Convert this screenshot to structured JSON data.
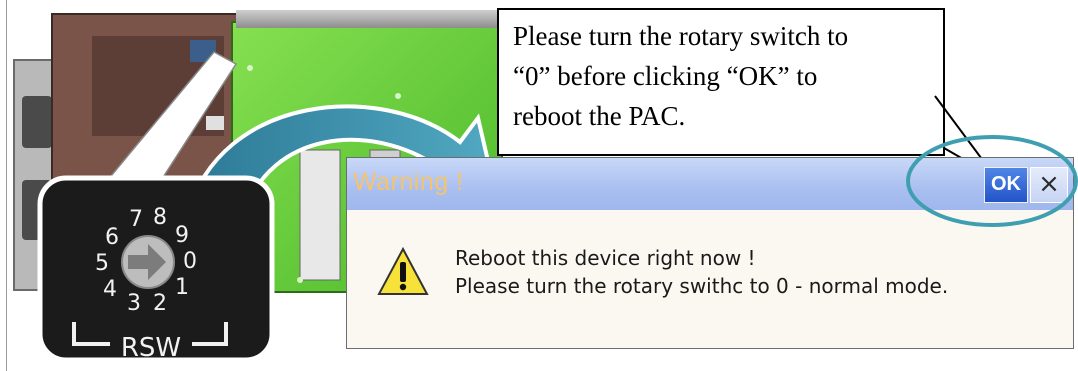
{
  "callout": {
    "lines": [
      "Please turn the rotary switch to",
      "“0” before clicking “OK” to",
      "reboot the PAC."
    ]
  },
  "rotary_switch": {
    "label": "RSW",
    "digits": [
      "0",
      "1",
      "2",
      "3",
      "4",
      "5",
      "6",
      "7",
      "8",
      "9"
    ]
  },
  "dialog": {
    "title": "Warning !",
    "ok_label": "OK",
    "close_label": "×",
    "message_line1": "Reboot this device right now !",
    "message_line2": "Please turn the rotary swithc to 0 - normal mode.",
    "icon": "warning-icon"
  },
  "colors": {
    "titlebar": "#a9bff0",
    "ok_button": "#2f62d6",
    "highlight": "#3f9fb0",
    "arrow": "#2a7f99",
    "board": "#6fd43a"
  }
}
